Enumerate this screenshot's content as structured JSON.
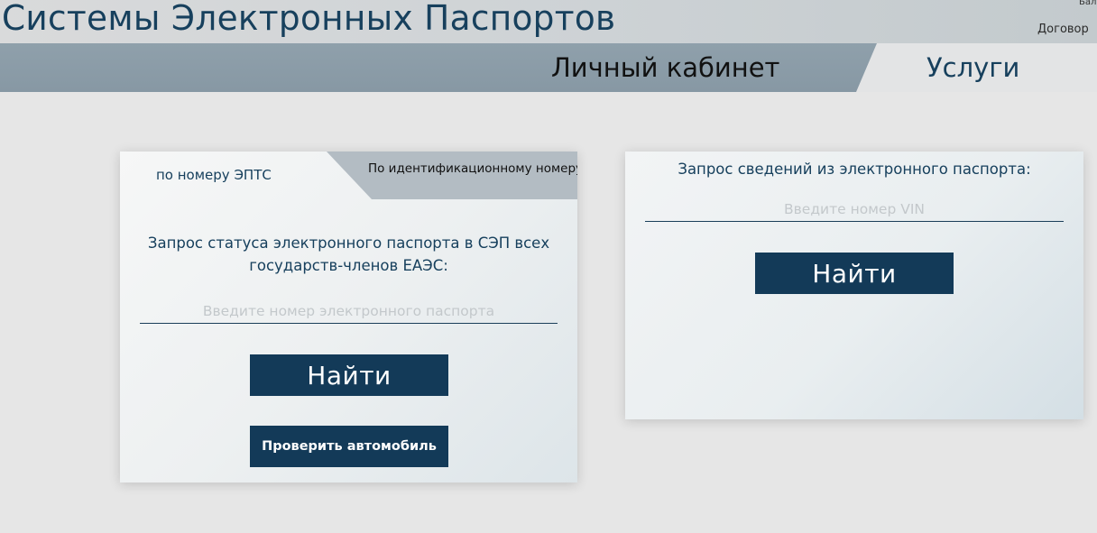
{
  "header": {
    "site_title": "Системы Электронных Паспортов",
    "balance_fragment": "Бал",
    "contract_fragment": "Договор"
  },
  "nav": {
    "cabinet": "Личный кабинет",
    "services": "Услуги"
  },
  "left_panel": {
    "tabs": {
      "by_epts": "по номеру ЭПТС",
      "by_id": "По идентификационному номеру"
    },
    "heading": "Запрос статуса электронного паспорта в СЭП всех государств-членов ЕАЭС:",
    "input_placeholder": "Введите номер электронного паспорта",
    "find_button": "Найти",
    "check_car_button": "Проверить автомобиль"
  },
  "right_panel": {
    "heading": "Запрос сведений из электронного паспорта:",
    "input_placeholder": "Введите номер VIN",
    "find_button": "Найти"
  },
  "colors": {
    "primary": "#133a58",
    "title": "#17405d",
    "nav_dark": "#8798a4",
    "tab_inactive": "#b3bcc3"
  }
}
